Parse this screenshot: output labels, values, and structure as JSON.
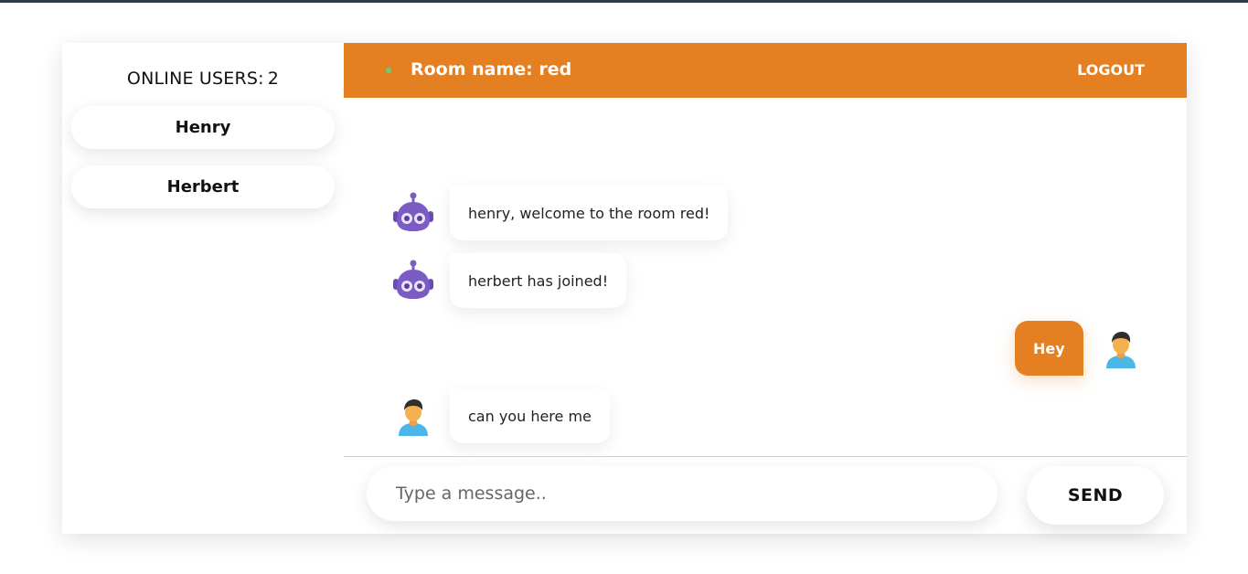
{
  "sidebar": {
    "title_label": "ONLINE USERS:",
    "count": "2",
    "users": [
      {
        "name": "Henry"
      },
      {
        "name": "Herbert"
      }
    ]
  },
  "header": {
    "room_name": "Room name: red",
    "logout_label": "LOGOUT",
    "accent_color": "#e47f22",
    "status_color": "#62d27a"
  },
  "messages": [
    {
      "side": "left",
      "avatar": "robot-icon",
      "text": "henry, welcome to the room red!"
    },
    {
      "side": "left",
      "avatar": "robot-icon",
      "text": "herbert has joined!"
    },
    {
      "side": "right",
      "avatar": "user-icon",
      "text": "Hey"
    },
    {
      "side": "left",
      "avatar": "user-icon",
      "text": "can you here me"
    }
  ],
  "composer": {
    "placeholder": "Type a message..",
    "value": "",
    "send_label": "SEND"
  }
}
